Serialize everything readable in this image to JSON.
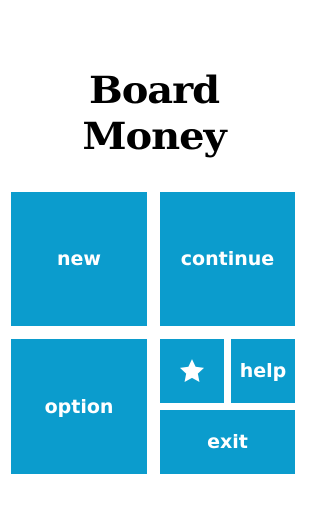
{
  "app": {
    "title_line1": "Board",
    "title_line2": "Money"
  },
  "menu": {
    "new_label": "new",
    "continue_label": "continue",
    "option_label": "option",
    "favorite_icon": "star-icon",
    "help_label": "help",
    "exit_label": "exit"
  },
  "colors": {
    "tile": "#0b9ccd",
    "tile_text": "#ffffff",
    "background": "#ffffff",
    "title_text": "#000000"
  }
}
